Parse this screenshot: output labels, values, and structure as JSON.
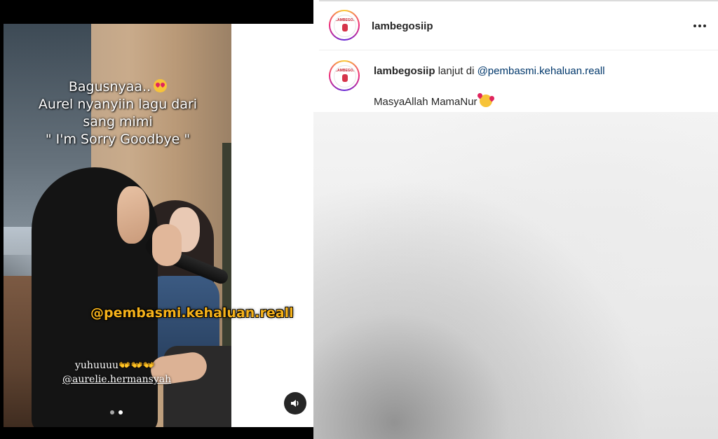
{
  "post": {
    "username": "lambegosiip",
    "avatar_logo_text": "LAMBEGOSIIP"
  },
  "comment": {
    "username": "lambegosiip",
    "text": "lanjut di",
    "mention": "@pembasmi.kehaluan.reall",
    "caption": "MasyaAllah MamaNur"
  },
  "media": {
    "caption_lines": [
      "Bagusnyaa..",
      "Aurel nyanyiin lagu dari",
      "sang mimi",
      "\" I'm Sorry Goodbye \""
    ],
    "overlay_mention": "@pembasmi.kehaluan.reall",
    "overlay_text_1": "yuhuuuu👐👐👐",
    "overlay_text_2": "@aurelie.hermansyah",
    "carousel": {
      "total": 2,
      "active": 2
    }
  },
  "icons": {
    "more": "more-options-icon",
    "mute": "speaker-icon",
    "caption_emoji": "heart-eyes-emoji",
    "comment_emoji": "smiling-face-with-hearts-emoji"
  },
  "colors": {
    "link": "#00376b",
    "mention_overlay": "#f6b21a",
    "text": "#262626"
  }
}
